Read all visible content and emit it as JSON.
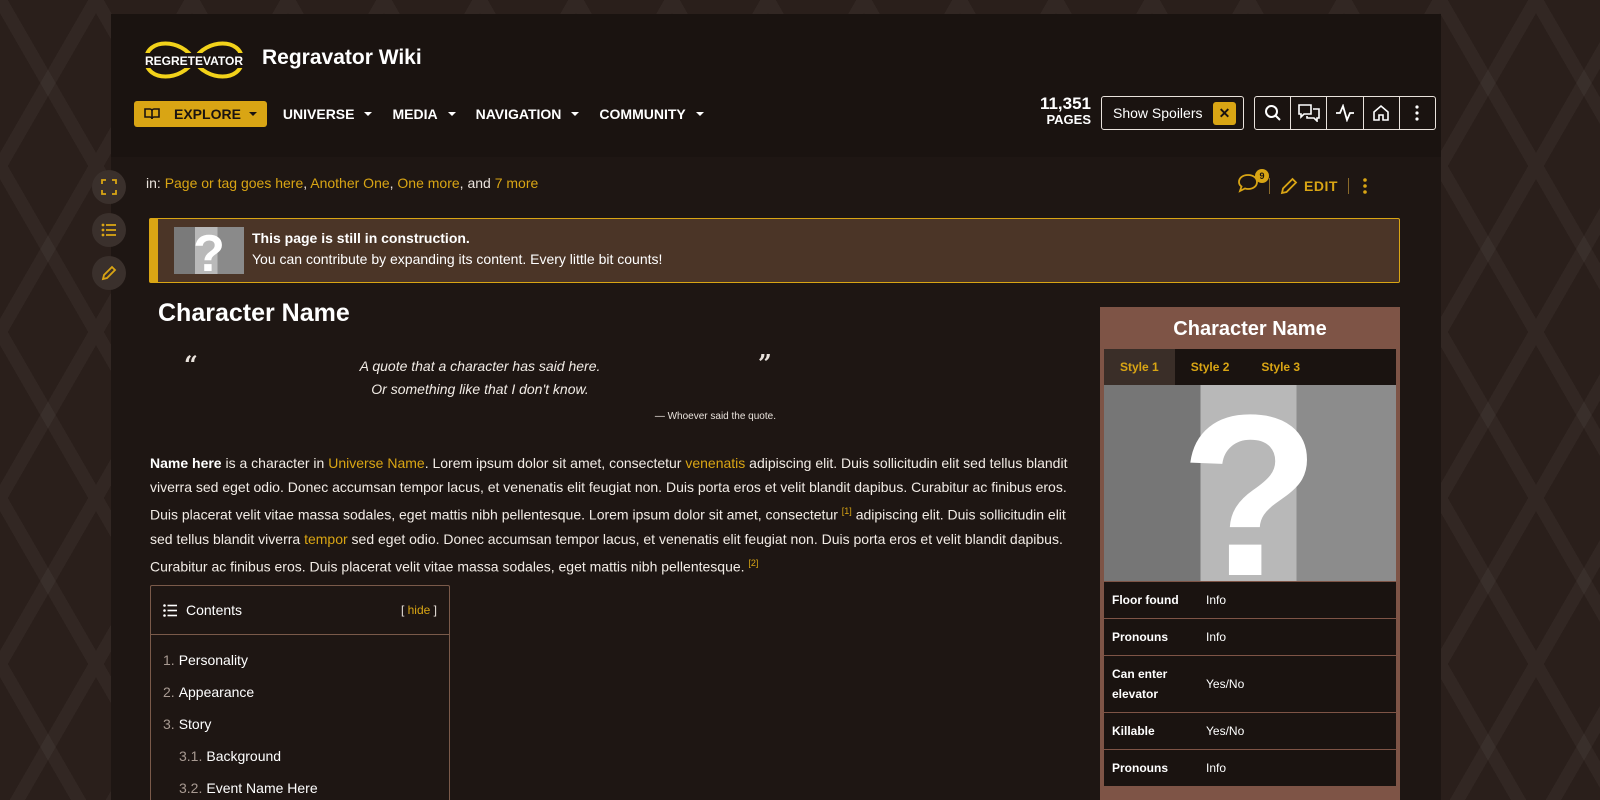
{
  "header": {
    "wiki_name": "Regravator Wiki",
    "logo_text": "REGRETEVATOR",
    "nav": [
      {
        "label": "EXPLORE"
      },
      {
        "label": "UNIVERSE"
      },
      {
        "label": "MEDIA"
      },
      {
        "label": "NAVIGATION"
      },
      {
        "label": "COMMUNITY"
      }
    ],
    "pages_count": "11,351",
    "pages_label": "PAGES",
    "show_spoilers": "Show Spoilers",
    "spoilers_close": "✕"
  },
  "breadcrumb": {
    "prefix": "in:",
    "links": [
      "Page or tag goes here",
      "Another One",
      "One more"
    ],
    "sep": ", ",
    "and": ", and",
    "more": "7 more"
  },
  "page_actions": {
    "comments_count": "9",
    "edit_label": "EDIT"
  },
  "notice": {
    "title": "This page is still in construction.",
    "text": "You can contribute by expanding its content. Every little bit counts!"
  },
  "article": {
    "title": "Character Name",
    "quote_open": "“",
    "quote_close": "”",
    "quote_line1": "A quote that a character has said here.",
    "quote_line2": "Or something like that I don't know.",
    "quote_source": "— Whoever said the quote.",
    "intro": {
      "name": "Name here",
      "t1": " is a character in ",
      "universe": "Universe Name",
      "t2": ". Lorem ipsum dolor sit amet, consectetur ",
      "word1": "venenatis",
      "t3": " adipiscing elit. Duis sollicitudin elit sed tellus blandit viverra sed eget odio. Donec accumsan tempor lacus, et venenatis elit feugiat non. Duis porta eros et velit blandit dapibus. Curabitur ac finibus eros. Duis placerat velit vitae massa sodales, eget mattis nibh pellentesque. Lorem ipsum dolor sit amet, consectetur ",
      "ref1": "[1]",
      "t4": " adipiscing elit. Duis sollicitudin elit sed tellus blandit viverra ",
      "word2": "tempor",
      "t5": " sed eget odio. Donec accumsan tempor lacus, et venenatis elit feugiat non. Duis porta eros et velit blandit dapibus. Curabitur ac finibus eros. Duis placerat velit vitae massa sodales, eget mattis nibh pellentesque. ",
      "ref2": "[2]"
    }
  },
  "toc": {
    "title": "Contents",
    "hide_open": "[",
    "hide": "hide",
    "hide_close": "]",
    "items": [
      {
        "num": "1.",
        "label": "Personality"
      },
      {
        "num": "2.",
        "label": "Appearance"
      },
      {
        "num": "3.",
        "label": "Story"
      },
      {
        "num": "3.1.",
        "label": "Background"
      },
      {
        "num": "3.2.",
        "label": "Event Name Here"
      }
    ]
  },
  "infobox": {
    "title": "Character Name",
    "tabs": [
      "Style 1",
      "Style 2",
      "Style 3"
    ],
    "rows": [
      {
        "k": "Floor found",
        "v": "Info"
      },
      {
        "k": "Pronouns",
        "v": "Info"
      },
      {
        "k": "Can enter elevator",
        "v": "Yes/No"
      },
      {
        "k": "Killable",
        "v": "Yes/No"
      },
      {
        "k": "Pronouns",
        "v": "Info"
      }
    ]
  },
  "colors": {
    "accent": "#d9a514",
    "background": "#1e1613",
    "infobox": "#7e5446"
  }
}
